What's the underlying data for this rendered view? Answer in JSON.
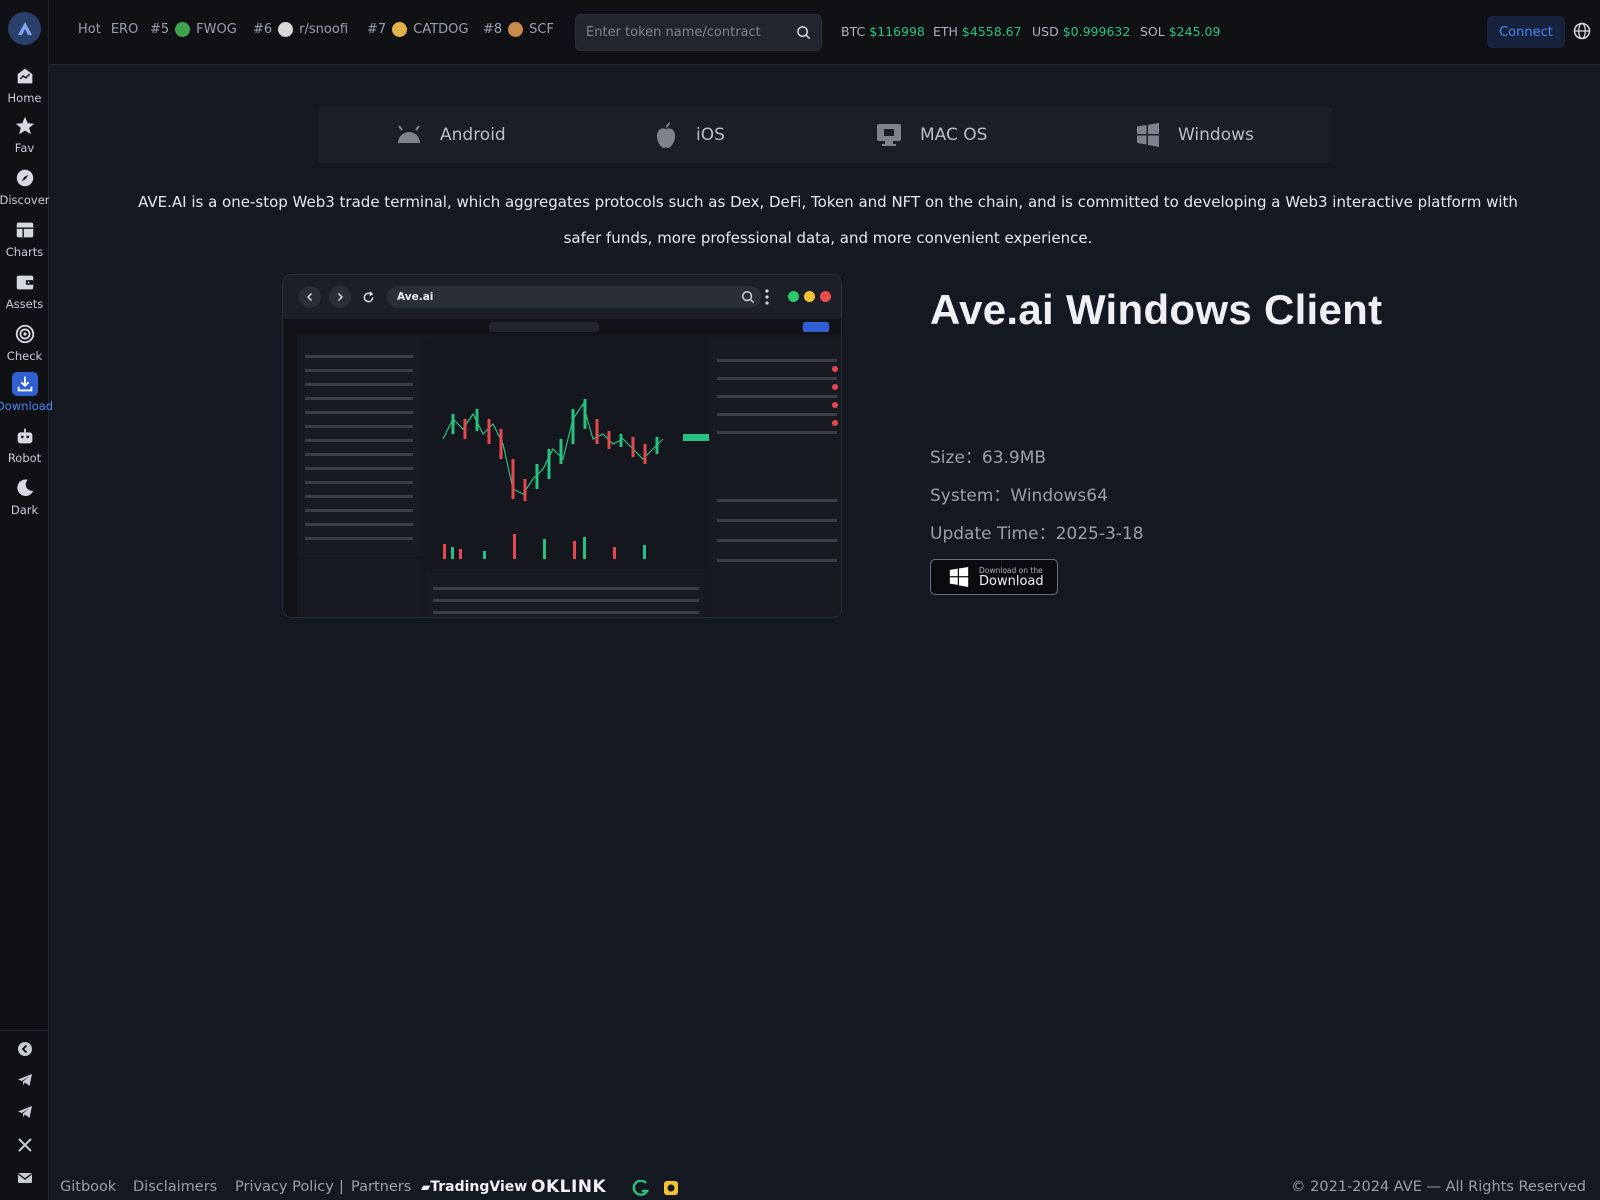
{
  "sidebar": {
    "items": [
      {
        "label": "Home"
      },
      {
        "label": "Fav"
      },
      {
        "label": "Discover"
      },
      {
        "label": "Charts"
      },
      {
        "label": "Assets"
      },
      {
        "label": "Check"
      },
      {
        "label": "Download"
      },
      {
        "label": "Robot"
      },
      {
        "label": "Dark"
      }
    ],
    "active": "Download"
  },
  "header": {
    "hot_label": "Hot",
    "hot_first": "ERO",
    "trending": [
      {
        "rank": "#5",
        "name": "FWOG",
        "color": "#3fa34d"
      },
      {
        "rank": "#6",
        "name": "r/snoofi",
        "color": "#d8d8d8"
      },
      {
        "rank": "#7",
        "name": "CATDOG",
        "color": "#e2b24a"
      },
      {
        "rank": "#8",
        "name": "SCF",
        "color": "#c98b4b"
      }
    ],
    "search_placeholder": "Enter token name/contract",
    "prices": [
      {
        "sym": "BTC",
        "val": "$116998"
      },
      {
        "sym": "ETH",
        "val": "$4558.67"
      },
      {
        "sym": "USD",
        "val": "$0.999632"
      },
      {
        "sym": "SOL",
        "val": "$245.09"
      }
    ],
    "connect_label": "Connect"
  },
  "platforms": [
    {
      "name": "Android"
    },
    {
      "name": "iOS"
    },
    {
      "name": "MAC OS"
    },
    {
      "name": "Windows"
    }
  ],
  "description": "AVE.AI is a one-stop Web3 trade terminal, which aggregates protocols such as Dex, DeFi, Token and NFT on the chain, and is committed to developing a Web3 interactive platform with safer funds, more professional data, and more convenient experience.",
  "preview": {
    "url": "Ave.ai"
  },
  "client": {
    "title": "Ave.ai Windows Client",
    "size": "Size：63.9MB",
    "system": "System：Windows64",
    "update": "Update Time：2025-3-18",
    "download_small": "Download on the",
    "download_big": "Download"
  },
  "footer": {
    "links": [
      "Gitbook",
      "Disclaimers",
      "Privacy Policy",
      "Partners"
    ],
    "separator": "|",
    "partner_tradingview": "TradingView",
    "partner_oklink": "OKLINK",
    "copyright": "© 2021-2024 AVE — All Rights Reserved"
  },
  "colors": {
    "accent": "#4a86f7",
    "price_up": "#27c27f",
    "price_down": "#e5484d",
    "background": "#141821"
  }
}
